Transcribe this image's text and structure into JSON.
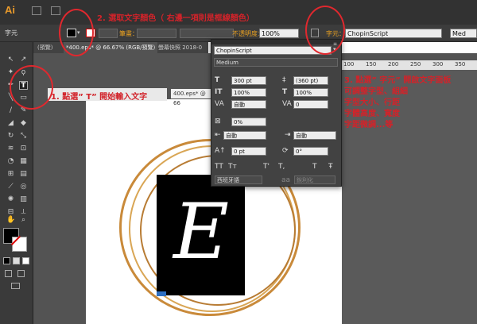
{
  "app": {
    "logo": "Ai"
  },
  "control_bar": {
    "label_char": "字元",
    "label_stroke": "筆畫：",
    "label_opacity": "不透明度：",
    "opacity_value": "100%",
    "label_char_link": "字元：",
    "font_value": "ChopinScript",
    "style_value": "Med"
  },
  "tabs": [
    {
      "label": "(預覽)"
    },
    {
      "label": "*400.eps* @ 66.67% (RGB/預覽)"
    },
    {
      "label": "螢幕快照 2018-0"
    }
  ],
  "second_doc_title": "400.eps* @ 66",
  "char_panel": {
    "font": "ChopinScript",
    "style": "Medium",
    "size": "300 pt",
    "leading": "(360 pt)",
    "vscale": "100%",
    "hscale": "100%",
    "kerning": "自動",
    "tracking": "0",
    "tsume": "0%",
    "aki_left": "自動",
    "aki_right": "自動",
    "baseline": "0 pt",
    "rotation": "0°",
    "tt1": "TT",
    "tt2": "Tт",
    "t1": "T'",
    "t2": "T,",
    "t3": "T",
    "t4": "Ŧ",
    "language": "西班牙語",
    "aa": "aa",
    "sharpen": "銳利化"
  },
  "artwork": {
    "letter": "E"
  },
  "annotations": {
    "step1": "1. 點選” T” 開始輸入文字",
    "step2": "2. 選取文字顏色（ 右邊一項則是框線顏色）",
    "step3_line1": "3. 點選” 字元” 開啟文字面板",
    "step3_line2": "可調整字型、組細",
    "step3_line3": "字型大小、行距",
    "step3_line4": "字體高度、寬度",
    "step3_line5": "字距微調...等"
  },
  "ruler_numbers": [
    "100",
    "150",
    "200",
    "250",
    "300",
    "350"
  ],
  "colors": {
    "accent_red": "#d2232a",
    "gold": "#c98a3a",
    "ui_dark": "#323232"
  }
}
